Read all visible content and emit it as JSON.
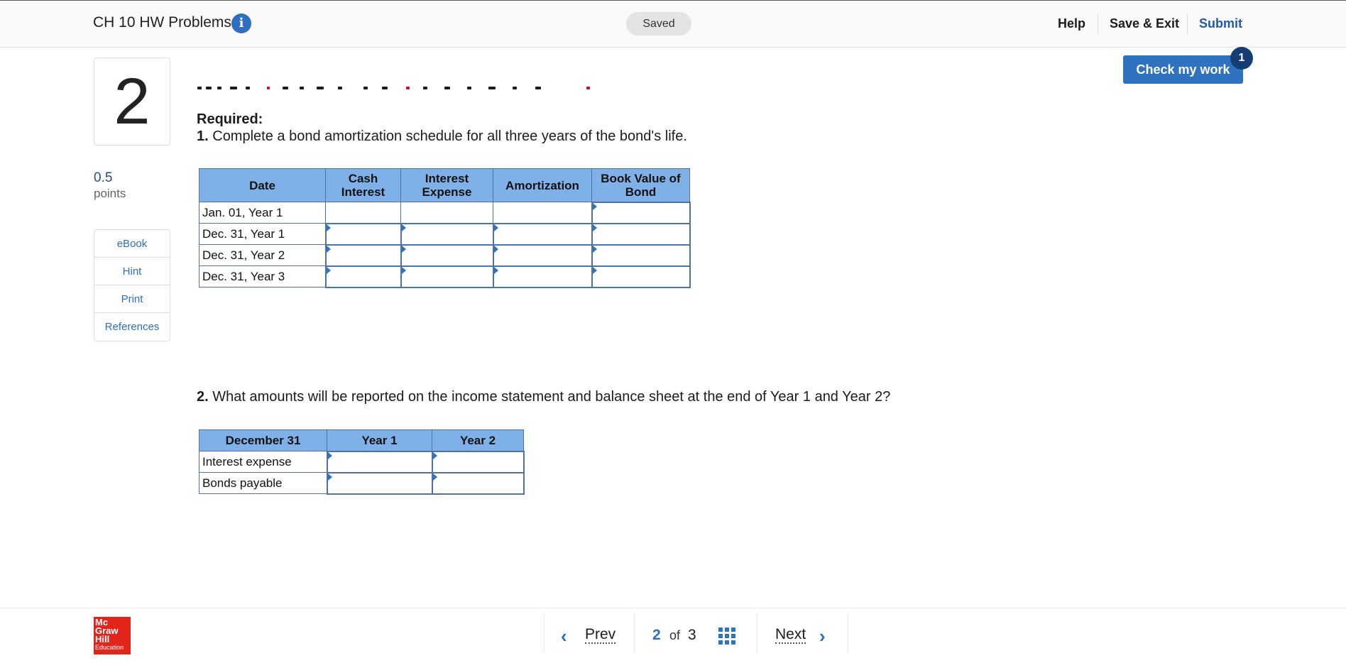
{
  "header": {
    "title": "CH 10 HW Problems",
    "info_icon": "info-icon",
    "saved": "Saved",
    "help": "Help",
    "save_exit": "Save & Exit",
    "submit": "Submit"
  },
  "question": {
    "number": "2",
    "points_value": "0.5",
    "points_label": "points",
    "tools": [
      "eBook",
      "Hint",
      "Print",
      "References"
    ]
  },
  "check": {
    "label": "Check my work",
    "badge": "1"
  },
  "content": {
    "required_label": "Required:",
    "q1_num": "1.",
    "q1_text": " Complete a bond amortization schedule for all three years of the bond's life.",
    "q2_num": "2.",
    "q2_text": " What amounts will be reported on the income statement and balance sheet at the end of Year 1 and Year 2?"
  },
  "table1": {
    "headers": [
      "Date",
      "Cash Interest",
      "Interest Expense",
      "Amortization",
      "Book Value of Bond"
    ],
    "rows": [
      "Jan. 01, Year 1",
      "Dec. 31, Year 1",
      "Dec. 31, Year 2",
      "Dec. 31, Year 3"
    ]
  },
  "table2": {
    "headers": [
      "December 31",
      "Year 1",
      "Year 2"
    ],
    "rows": [
      "Interest expense",
      "Bonds payable"
    ]
  },
  "footer": {
    "logo_lines": [
      "Mc",
      "Graw",
      "Hill",
      "Education"
    ],
    "prev": "Prev",
    "page_current": "2",
    "page_of": "of",
    "page_total": "3",
    "next": "Next"
  }
}
